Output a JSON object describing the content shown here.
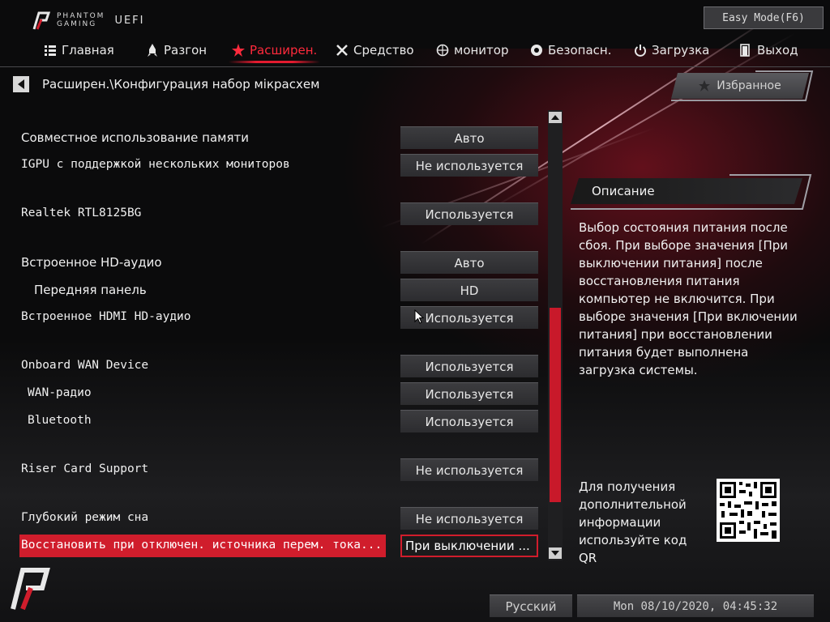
{
  "header": {
    "brand_line1": "PHANTOM",
    "brand_line2": "GAMING",
    "uefi": "UEFI",
    "easy_mode": "Easy Mode(F6)"
  },
  "nav": [
    {
      "label": "Главная",
      "icon": "list-icon"
    },
    {
      "label": "Разгон",
      "icon": "rocket-icon"
    },
    {
      "label": "Расширен.",
      "icon": "star-icon",
      "active": true
    },
    {
      "label": "Средство",
      "icon": "tools-icon"
    },
    {
      "label": "монитор",
      "icon": "monitor-icon"
    },
    {
      "label": "Безопасн.",
      "icon": "shield-icon"
    },
    {
      "label": "Загрузка",
      "icon": "power-icon"
    },
    {
      "label": "Выход",
      "icon": "exit-icon"
    }
  ],
  "breadcrumb": "Расширен.\\Конфигурация набор мікрасхем",
  "favorites_label": "Избранное",
  "settings": [
    {
      "label": "Совместное использование памяти",
      "value": "Авто"
    },
    {
      "label": "IGPU с поддержкой нескольких мониторов",
      "value": "Не используется"
    },
    {
      "label": "Realtek RTL8125BG",
      "value": "Используется"
    },
    {
      "label": "Встроенное HD-аудио",
      "value": "Авто"
    },
    {
      "label": "Передняя панель",
      "value": "HD"
    },
    {
      "label": "Встроенное HDMI HD-аудио",
      "value": "Используется"
    },
    {
      "label": "Onboard WAN Device",
      "value": "Используется"
    },
    {
      "label": "WAN-радио",
      "value": "Используется"
    },
    {
      "label": "Bluetooth",
      "value": "Используется"
    },
    {
      "label": "Riser Card Support",
      "value": "Не используется"
    },
    {
      "label": "Глубокий режим сна",
      "value": "Не используется"
    },
    {
      "label": "Восстановить при отключен. источника перем. тока...",
      "value": "При выключении ...",
      "selected": true
    }
  ],
  "description": {
    "title": "Описание",
    "text": "Выбор состояния питания после сбоя. При выборе значения [При выключении питания] после восстановления питания компьютер не включится. При выборе значения [При включении питания] при восстановлении питания будет выполнена загрузка системы."
  },
  "qr_info": "Для получения дополнительной информации используйте код QR",
  "footer": {
    "language": "Русский",
    "datetime": "Mon 08/10/2020, 04:45:32"
  },
  "colors": {
    "accent": "#d01d2c",
    "active_tab": "#ff2a3c",
    "value_box": "#3c3c3f"
  }
}
